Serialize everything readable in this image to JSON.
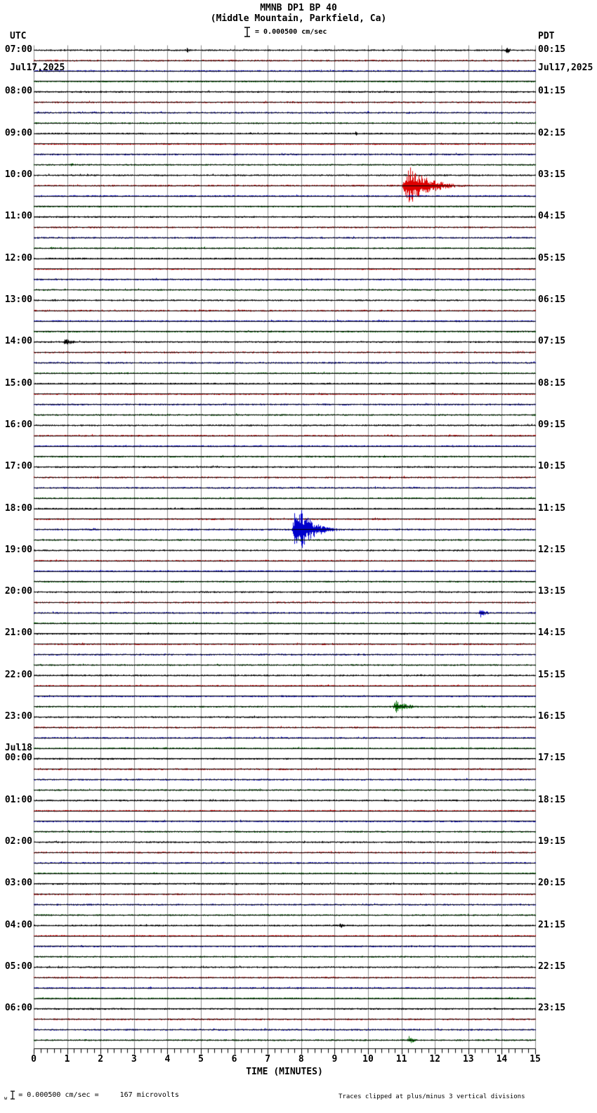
{
  "header": {
    "title": "MMNB DP1 BP 40",
    "subtitle": "(Middle Mountain, Parkfield, Ca)",
    "scale_label": "= 0.000500 cm/sec",
    "left_tz": "UTC",
    "left_date": "Jul17,2025",
    "right_tz": "PDT",
    "right_date": "Jul17,2025"
  },
  "axis": {
    "label": "TIME (MINUTES)",
    "tick_labels": [
      "0",
      "1",
      "2",
      "3",
      "4",
      "5",
      "6",
      "7",
      "8",
      "9",
      "10",
      "11",
      "12",
      "13",
      "14",
      "15"
    ],
    "minutes_per_row": 15
  },
  "footer": {
    "tiny_mark": "w",
    "scale_text": "= 0.000500 cm/sec =",
    "microvolts_text": "167 microvolts",
    "clip_note": "Traces clipped at plus/minus 3 vertical divisions"
  },
  "chart_data": {
    "type": "line",
    "subtype": "helicorder-seismogram",
    "station": "MMNB DP1 BP 40",
    "location": "Middle Mountain, Parkfield, Ca",
    "rows": 96,
    "minutes_per_row": 15,
    "trace_color_cycle": [
      "#000000",
      "#dd0000",
      "#0000cc",
      "#006600"
    ],
    "grid_color": "#8c8c8c",
    "baseline_color": "#000000",
    "clip_divisions": 3,
    "base_noise_amp": 1.3,
    "left_labels": [
      "07:00",
      "08:00",
      "09:00",
      "10:00",
      "11:00",
      "12:00",
      "13:00",
      "14:00",
      "15:00",
      "16:00",
      "17:00",
      "18:00",
      "19:00",
      "20:00",
      "21:00",
      "22:00",
      "23:00",
      "00:00",
      "01:00",
      "02:00",
      "03:00",
      "04:00",
      "05:00",
      "06:00"
    ],
    "right_labels": [
      "00:15",
      "01:15",
      "02:15",
      "03:15",
      "04:15",
      "05:15",
      "06:15",
      "07:15",
      "08:15",
      "09:15",
      "10:15",
      "11:15",
      "12:15",
      "13:15",
      "14:15",
      "15:15",
      "16:15",
      "17:15",
      "18:15",
      "19:15",
      "20:15",
      "21:15",
      "22:15",
      "23:15"
    ],
    "date_change": {
      "index": 17,
      "label": "Jul18"
    },
    "events": [
      {
        "row": 0,
        "utc": "07:00",
        "color": "black",
        "start_min": 4.55,
        "end_min": 4.95,
        "amp": 4
      },
      {
        "row": 0,
        "utc": "07:00",
        "color": "black",
        "start_min": 14.1,
        "end_min": 14.55,
        "amp": 7
      },
      {
        "row": 8,
        "utc": "09:00",
        "color": "black",
        "start_min": 9.6,
        "end_min": 9.85,
        "amp": 5
      },
      {
        "row": 11,
        "utc": "09:45",
        "color": "green",
        "start_min": 1.05,
        "end_min": 1.9,
        "amp": 3
      },
      {
        "row": 13,
        "utc": "10:15",
        "color": "red",
        "start_min": 11.0,
        "end_min": 13.9,
        "amp": 28,
        "clipped": true
      },
      {
        "row": 28,
        "utc": "14:00",
        "color": "black",
        "start_min": 0.85,
        "end_min": 2.1,
        "amp": 5
      },
      {
        "row": 41,
        "utc": "17:15",
        "color": "red",
        "start_min": 10.6,
        "end_min": 10.9,
        "amp": 3
      },
      {
        "row": 45,
        "utc": "18:15",
        "color": "red",
        "start_min": 10.1,
        "end_min": 11.3,
        "amp": 2.5
      },
      {
        "row": 46,
        "utc": "18:30",
        "color": "blue",
        "start_min": 0.7,
        "end_min": 0.95,
        "amp": 3.5
      },
      {
        "row": 46,
        "utc": "18:30",
        "color": "blue",
        "start_min": 7.7,
        "end_min": 9.7,
        "amp": 40,
        "clipped": true
      },
      {
        "row": 46,
        "utc": "18:30",
        "color": "blue",
        "start_min": 8.3,
        "end_min": 8.65,
        "amp": 13
      },
      {
        "row": 54,
        "utc": "20:30",
        "color": "blue",
        "start_min": 13.3,
        "end_min": 14.1,
        "amp": 7
      },
      {
        "row": 59,
        "utc": "21:45",
        "color": "green",
        "start_min": 0.55,
        "end_min": 0.9,
        "amp": 3
      },
      {
        "row": 63,
        "utc": "22:45",
        "color": "green",
        "start_min": 10.7,
        "end_min": 12.5,
        "amp": 9
      },
      {
        "row": 76,
        "utc": "02:00",
        "color": "black",
        "start_min": 12.15,
        "end_min": 12.6,
        "amp": 3
      },
      {
        "row": 84,
        "utc": "04:00",
        "color": "black",
        "start_min": 9.1,
        "end_min": 9.95,
        "amp": 4.5
      },
      {
        "row": 95,
        "utc": "06:45",
        "color": "green",
        "start_min": 11.15,
        "end_min": 12.0,
        "amp": 6
      }
    ]
  }
}
